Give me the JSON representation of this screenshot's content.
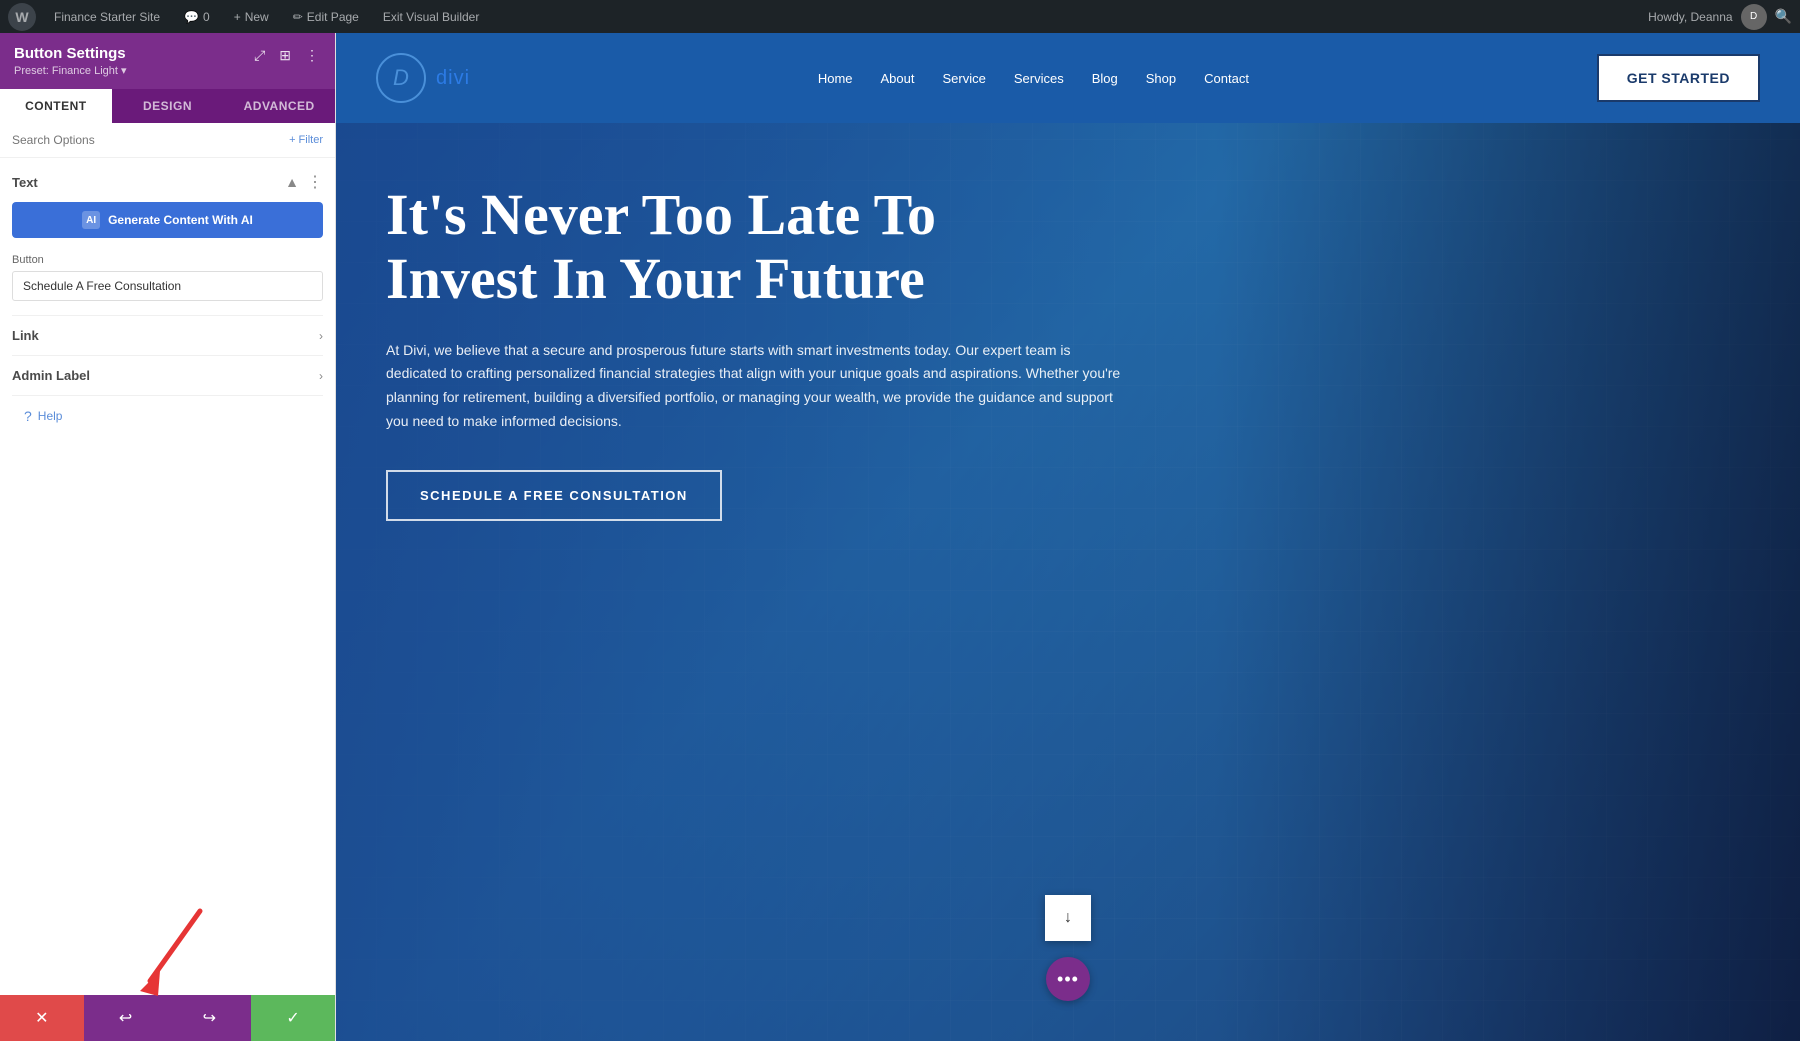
{
  "admin_bar": {
    "site_name": "Finance Starter Site",
    "comments_count": "0",
    "new_label": "New",
    "edit_page_label": "Edit Page",
    "exit_builder_label": "Exit Visual Builder",
    "howdy_label": "Howdy, Deanna",
    "wp_icon": "W"
  },
  "sidebar": {
    "title": "Button Settings",
    "preset": "Preset: Finance Light ▾",
    "tabs": [
      "Content",
      "Design",
      "Advanced"
    ],
    "active_tab": "Content",
    "search_placeholder": "Search Options",
    "filter_label": "+ Filter",
    "text_section_title": "Text",
    "ai_button_label": "Generate Content With AI",
    "ai_icon_label": "AI",
    "button_field_label": "Button",
    "button_field_value": "Schedule A Free Consultation",
    "link_section_title": "Link",
    "admin_label_section_title": "Admin Label",
    "help_label": "Help",
    "bottom_buttons": {
      "cancel": "✕",
      "undo": "↩",
      "redo": "↪",
      "save": "✓"
    }
  },
  "site_nav": {
    "logo_letter": "D",
    "logo_text": "divi",
    "links": [
      "Home",
      "About",
      "Service",
      "Services",
      "Blog",
      "Shop",
      "Contact"
    ],
    "cta_button": "GET STARTED"
  },
  "hero": {
    "title_line1": "It's Never Too Late To",
    "title_line2": "Invest In Your Future",
    "description": "At Divi, we believe that a secure and prosperous future starts with smart investments today. Our expert team is dedicated to crafting personalized financial strategies that align with your unique goals and aspirations. Whether you're planning for retirement, building a diversified portfolio, or managing your wealth, we provide the guidance and support you need to make informed decisions.",
    "cta_button": "SCHEDULE A FREE CONSULTATION"
  },
  "icons": {
    "wp_logo": "W",
    "collapse_icon": "▲",
    "expand_icon": "▼",
    "more_icon": "⋮",
    "chevron_down": "›",
    "scroll_down_arrow": "↓",
    "three_dots": "•••",
    "close_icon": "×",
    "undo_icon": "↩",
    "redo_icon": "↪",
    "check_icon": "✓",
    "comment_icon": "💬",
    "plus_icon": "+",
    "pencil_icon": "✏",
    "search_icon": "🔍",
    "help_circle": "?"
  },
  "colors": {
    "sidebar_header_bg": "#7b2d8b",
    "sidebar_tab_active_bg": "#ffffff",
    "sidebar_tab_inactive_bg": "#6a1a7a",
    "ai_button_bg": "#3a6fd8",
    "nav_bg": "#1a5ba8",
    "hero_bg_start": "#1a5ba8",
    "hero_bg_end": "#1a3a6b",
    "cancel_btn": "#e04a4a",
    "save_btn": "#5cb85c",
    "undo_redo_btn": "#7b2d8b",
    "admin_bar_bg": "#1d2327"
  }
}
